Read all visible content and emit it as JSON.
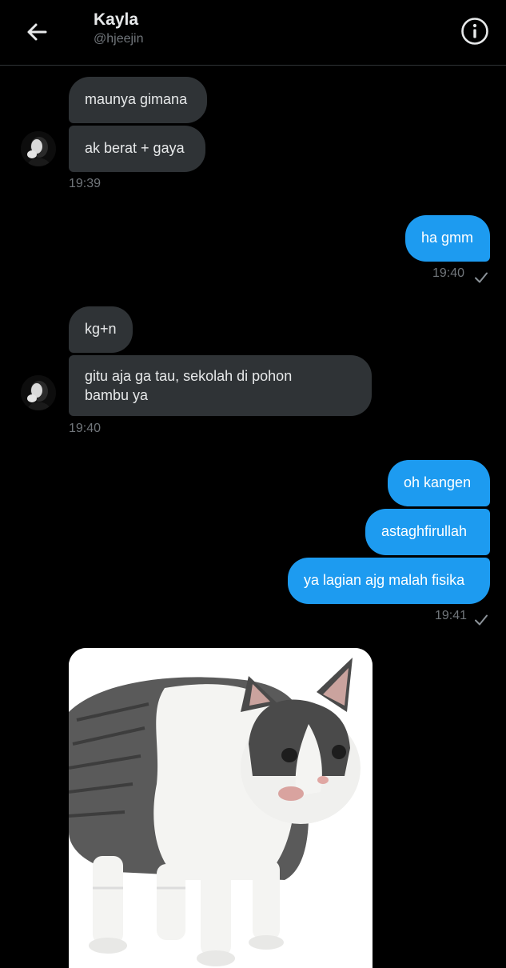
{
  "header": {
    "name": "Kayla",
    "handle": "@hjeejin"
  },
  "messages": {
    "m1": "maunya gimana",
    "m2": "ak berat + gaya",
    "t1": "19:39",
    "m3": "ha gmm",
    "t2": "19:40",
    "m4": "kg+n",
    "m5": "gitu aja ga tau, sekolah di pohon\nbambu ya",
    "t3": "19:40",
    "m6": "oh kangen",
    "m7": "astaghfirullah",
    "m8": "ya lagian ajg malah fisika",
    "t4": "19:41"
  },
  "colors": {
    "background": "#000000",
    "incoming_bubble": "#2f3336",
    "outgoing_bubble": "#1d9bf0",
    "muted_text": "#71767b"
  },
  "icons": {
    "back": "arrow-left-icon",
    "info": "info-icon",
    "sent": "checkmark-icon"
  }
}
